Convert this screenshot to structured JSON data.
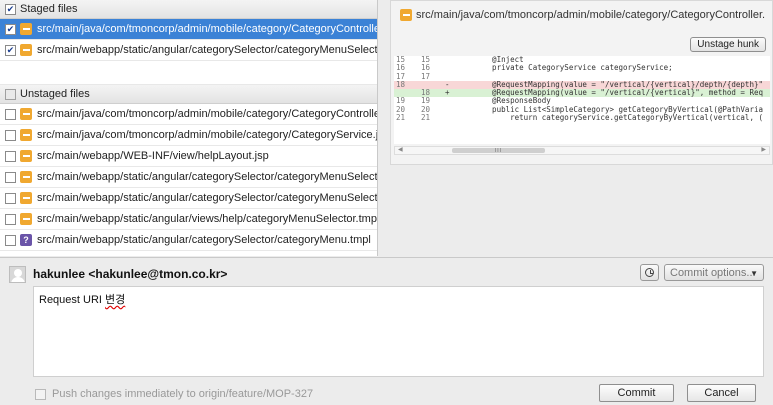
{
  "staged": {
    "header": "Staged files",
    "files": [
      {
        "path": "src/main/java/com/tmoncorp/admin/mobile/category/CategoryController.java",
        "status": "modified",
        "checked": true,
        "selected": true
      },
      {
        "path": "src/main/webapp/static/angular/categorySelector/categoryMenuSelector.js",
        "status": "modified",
        "checked": true,
        "selected": false
      }
    ]
  },
  "unstaged": {
    "header": "Unstaged files",
    "files": [
      {
        "path": "src/main/java/com/tmoncorp/admin/mobile/category/CategoryController.java",
        "status": "modified"
      },
      {
        "path": "src/main/java/com/tmoncorp/admin/mobile/category/CategoryService.java",
        "status": "modified"
      },
      {
        "path": "src/main/webapp/WEB-INF/view/helpLayout.jsp",
        "status": "modified"
      },
      {
        "path": "src/main/webapp/static/angular/categorySelector/categoryMenuSelector.js",
        "status": "modified"
      },
      {
        "path": "src/main/webapp/static/angular/categorySelector/categoryMenuSelector.tmpl",
        "status": "modified"
      },
      {
        "path": "src/main/webapp/static/angular/views/help/categoryMenuSelector.tmpl",
        "status": "modified"
      },
      {
        "path": "src/main/webapp/static/angular/categorySelector/categoryMenu.tmpl",
        "status": "unknown",
        "glyph": "?"
      }
    ]
  },
  "diff": {
    "file_title": "src/main/java/com/tmoncorp/admin/mobile/category/CategoryController.",
    "more_label": "...",
    "unstage_hunk_label": "Unstage hunk",
    "lines": [
      {
        "old": "15",
        "new": "15",
        "marker": "",
        "text": "    @Inject",
        "type": "context"
      },
      {
        "old": "16",
        "new": "16",
        "marker": "",
        "text": "    private CategoryService categoryService;",
        "type": "context"
      },
      {
        "old": "17",
        "new": "17",
        "marker": "",
        "text": "",
        "type": "context"
      },
      {
        "old": "18",
        "new": "",
        "marker": "-",
        "text": "    @RequestMapping(value = \"/vertical/{vertical}/depth/{depth}\"",
        "type": "removed"
      },
      {
        "old": "",
        "new": "18",
        "marker": "+",
        "text": "    @RequestMapping(value = \"/vertical/{vertical}\", method = Req",
        "type": "added"
      },
      {
        "old": "19",
        "new": "19",
        "marker": "",
        "text": "    @ResponseBody",
        "type": "context"
      },
      {
        "old": "20",
        "new": "20",
        "marker": "",
        "text": "    public List<SimpleCategory> getCategoryByVertical(@PathVaria",
        "type": "context"
      },
      {
        "old": "21",
        "new": "21",
        "marker": "",
        "text": "        return categoryService.getCategoryByVertical(vertical, (",
        "type": "context"
      }
    ],
    "scroll_thumb_label": "III"
  },
  "commit": {
    "author": "hakunlee <hakunlee@tmon.co.kr>",
    "options_label": "Commit options...",
    "message_prefix": "Request URI ",
    "message_korean": "변경",
    "push_label": "Push changes immediately to origin/feature/MOP-327",
    "commit_label": "Commit",
    "cancel_label": "Cancel"
  },
  "colors": {
    "selection": "#3b82d6",
    "modified_status": "#f0a830",
    "unknown_status": "#6a54a8",
    "removed_line": "#f8d7d7",
    "added_line": "#d9f1d4"
  }
}
